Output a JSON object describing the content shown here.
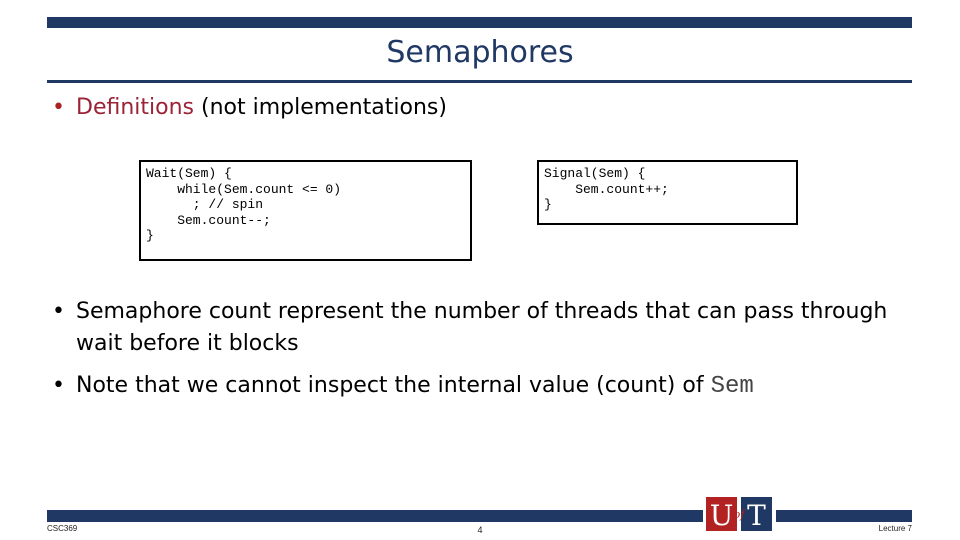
{
  "slide": {
    "title": "Semaphores",
    "bullet1": {
      "highlight": "Definitions",
      "rest": "(not implementations)"
    },
    "code_wait": [
      "Wait(Sem) {",
      "    while(Sem.count <= 0)",
      "      ; // spin",
      "    Sem.count--;",
      "}"
    ],
    "code_signal": [
      "Signal(Sem) {",
      "    Sem.count++;",
      "}"
    ],
    "bullet2": "Semaphore count represent the number of threads that can pass through wait before it blocks",
    "bullet3": {
      "text": "Note that we cannot inspect the internal value (count) of",
      "code": "Sem"
    }
  },
  "footer": {
    "course": "CSC369",
    "page_number": "4",
    "lecture": "Lecture 7",
    "logo_text": "U of T"
  },
  "colors": {
    "navy": "#1f3864",
    "red": "#9b2335"
  }
}
